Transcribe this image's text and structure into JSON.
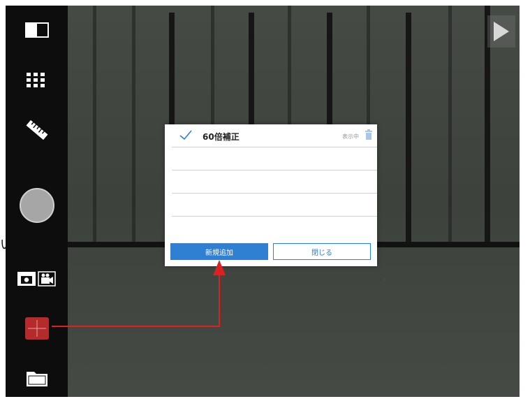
{
  "dialog": {
    "items": [
      {
        "label": "60倍補正",
        "meta": "表示中",
        "checked": true
      },
      {
        "label": "",
        "meta": ""
      },
      {
        "label": "",
        "meta": ""
      },
      {
        "label": "",
        "meta": ""
      }
    ],
    "add_button": "新規追加",
    "close_button": "閉じる"
  },
  "side_text": "い",
  "colors": {
    "accent": "#2f7fd2",
    "annotation": "#e02020",
    "active_tool": "#b52a2a"
  },
  "icons": [
    "layout-icon",
    "grid-icon",
    "ruler-icon",
    "shutter-button",
    "photo-icon",
    "video-icon",
    "calibration-icon",
    "folder-icon",
    "play-icon",
    "check-icon",
    "trash-icon"
  ]
}
